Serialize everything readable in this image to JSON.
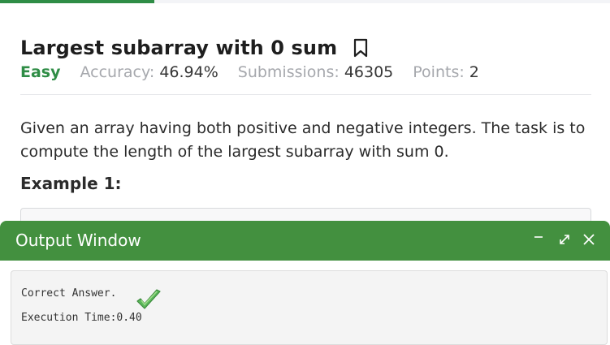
{
  "problem": {
    "title": "Largest subarray with 0 sum",
    "difficulty": "Easy",
    "accuracy_label": "Accuracy:",
    "accuracy_value": "46.94%",
    "submissions_label": "Submissions:",
    "submissions_value": "46305",
    "points_label": "Points:",
    "points_value": "2",
    "description": "Given an array having both positive and negative integers. The task is to compute the length of the largest subarray with sum 0.",
    "example_heading": "Example 1:"
  },
  "output_window": {
    "title": "Output Window",
    "result_text": "Correct Answer.",
    "execution_time": "Execution Time:0.40"
  },
  "colors": {
    "accent_green": "#2f8d46",
    "titlebar_green": "#43903f"
  },
  "icons": [
    "bookmark-icon",
    "minimize-icon",
    "expand-icon",
    "close-icon",
    "checkmark-icon"
  ]
}
